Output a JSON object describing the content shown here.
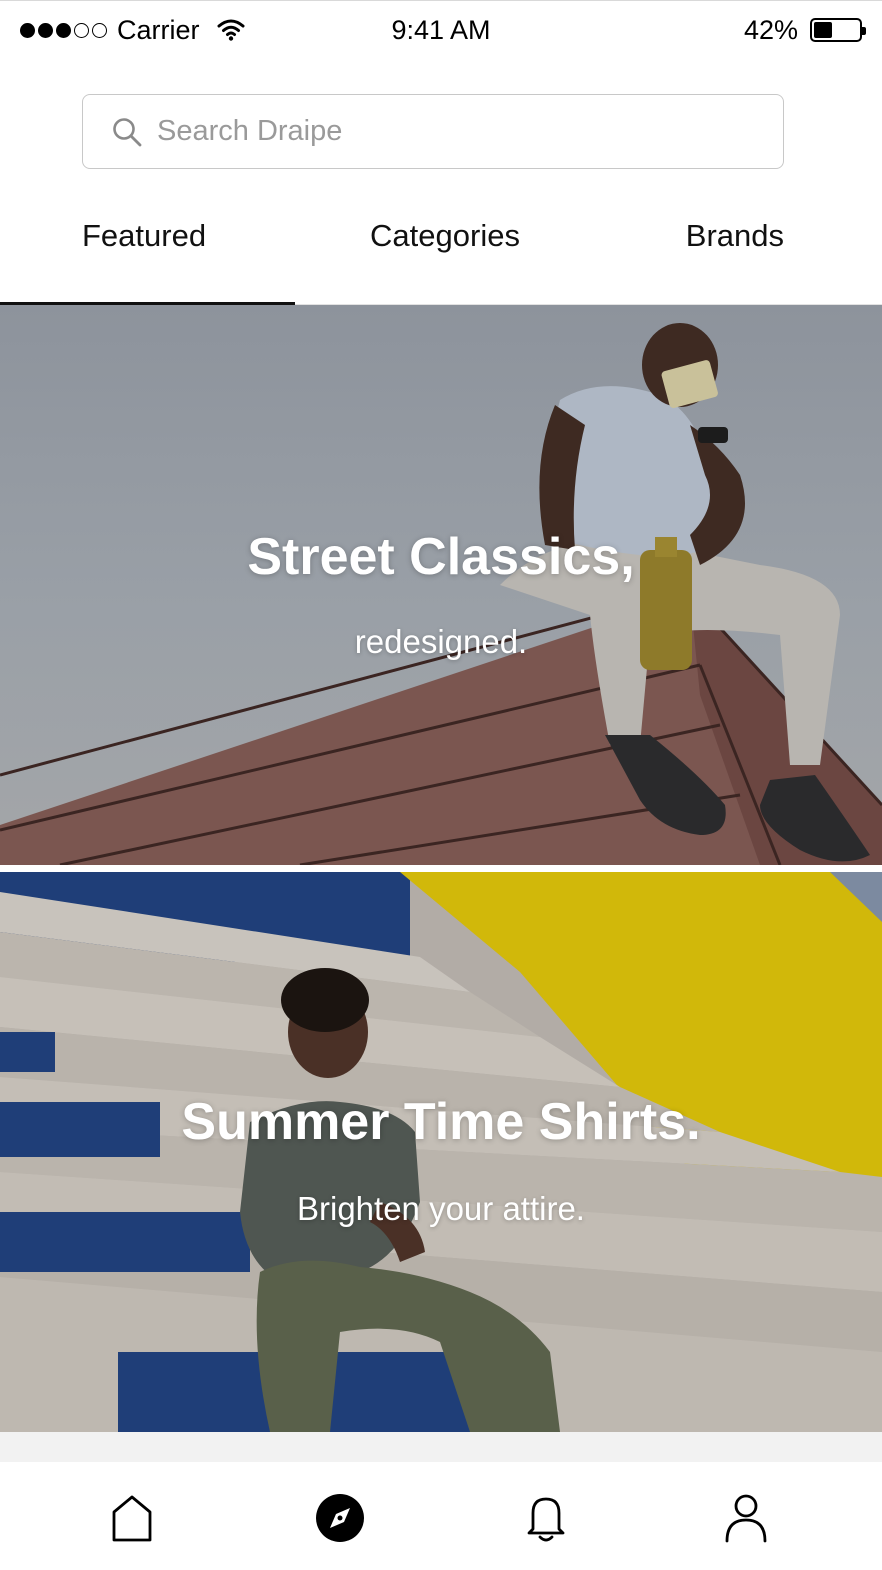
{
  "status_bar": {
    "carrier": "Carrier",
    "time": "9:41 AM",
    "battery": "42%",
    "battery_level": 0.42,
    "signal_bars_filled": 3,
    "signal_bars_total": 5
  },
  "search": {
    "placeholder": "Search Draipe",
    "value": ""
  },
  "tabs": [
    {
      "label": "Featured",
      "active": true
    },
    {
      "label": "Categories",
      "active": false
    },
    {
      "label": "Brands",
      "active": false
    }
  ],
  "banners": [
    {
      "title": "Street Classics,",
      "subtitle": "redesigned."
    },
    {
      "title": "Summer Time Shirts.",
      "subtitle": "Brighten your attire."
    }
  ],
  "bottom_nav": [
    {
      "icon": "home-icon",
      "active": false
    },
    {
      "icon": "compass-icon",
      "active": true
    },
    {
      "icon": "bell-icon",
      "active": false
    },
    {
      "icon": "profile-icon",
      "active": false
    }
  ],
  "colors": {
    "text": "#111111",
    "placeholder": "#9a9a9a",
    "accent": "#000000",
    "banner_yellow": "#d1b80a",
    "banner_blue": "#1e3f7c"
  }
}
